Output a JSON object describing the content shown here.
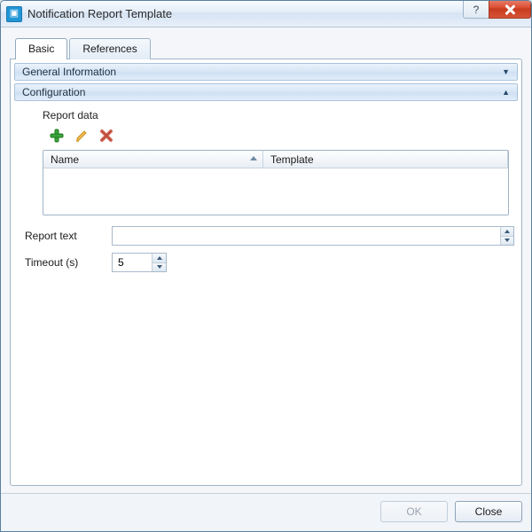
{
  "window": {
    "title": "Notification Report Template"
  },
  "tabs": {
    "basic": "Basic",
    "references": "References",
    "active": "basic"
  },
  "sections": {
    "general_info": {
      "title": "General Information",
      "expanded": false
    },
    "configuration": {
      "title": "Configuration",
      "expanded": true
    }
  },
  "config": {
    "report_data_label": "Report data",
    "table": {
      "col_name": "Name",
      "col_template": "Template",
      "rows": []
    },
    "report_text": {
      "label": "Report text",
      "value": ""
    },
    "timeout": {
      "label": "Timeout (s)",
      "value": "5"
    }
  },
  "toolbar": {
    "add_name": "add-icon",
    "edit_name": "edit-icon",
    "delete_name": "delete-icon"
  },
  "footer": {
    "ok": "OK",
    "close": "Close",
    "ok_enabled": false
  },
  "colors": {
    "accent_blue": "#cfe0f3",
    "border_blue": "#9fb4c9",
    "close_red": "#c73a1e"
  }
}
